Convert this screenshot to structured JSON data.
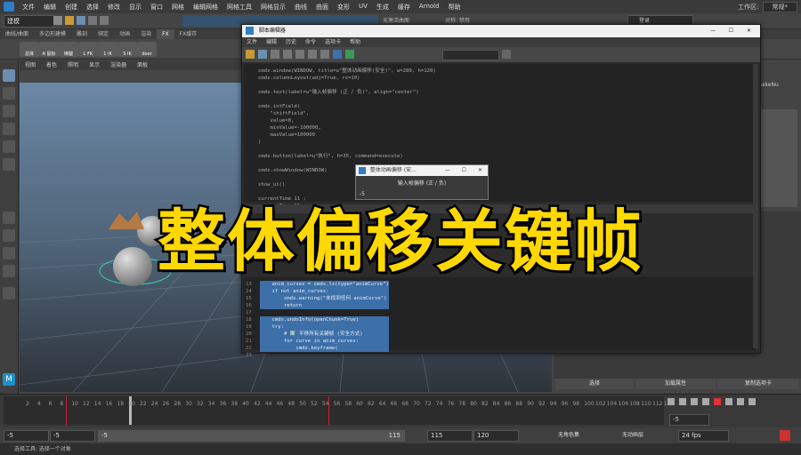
{
  "menubar": {
    "items": [
      "文件",
      "编辑",
      "创建",
      "选择",
      "修改",
      "显示",
      "窗口",
      "网格",
      "编辑网格",
      "网格工具",
      "网格显示",
      "曲线",
      "曲面",
      "变形",
      "UV",
      "生成",
      "缓存",
      "Arnold",
      "帮助"
    ],
    "workspace_label": "工作区:",
    "workspace_value": "常规*"
  },
  "toolbar": {
    "mode": "建模",
    "no_live": "无激活曲面",
    "symmetry": "对称: 禁用",
    "user": "登录"
  },
  "shelf": {
    "tabs": [
      "曲线/曲面",
      "多边形建模",
      "雕刻",
      "绑定",
      "动画",
      "渲染",
      "FX",
      "FX缓存"
    ],
    "buttons": [
      "总体",
      "A 鼠标",
      "绑腿",
      "L FK",
      "1 IK",
      "S IK",
      "door"
    ]
  },
  "viewport": {
    "menu": [
      "视图",
      "着色",
      "照明",
      "显示",
      "渲染器",
      "面板"
    ]
  },
  "script_editor": {
    "title": "脚本编辑器",
    "menu": [
      "文件",
      "编辑",
      "历史",
      "命令",
      "选项卡",
      "帮助"
    ],
    "output_lines": [
      "cmds.window(WINDOW, title=u\"整体动画偏移(安全)\", w=280, h=120)",
      "cmds.columnLayout(adj=True, rs=10)",
      "",
      "cmds.text(label=u\"输入帧偏移 (正 / 负)\", align=\"center\")",
      "",
      "cmds.intField(",
      "    \"shiftField\",",
      "    value=0,",
      "    minValue=-100000,",
      "    maxValue=100000",
      ")",
      "",
      "cmds.button(label=u\"执行\", h=35, command=execute)",
      "",
      "cmds.showWindow(WINDOW)",
      "",
      "show_ui()",
      "",
      "currentTime 11 ;",
      "currentTime 11 ;"
    ],
    "input_line_numbers": [
      "13",
      "14",
      "15",
      "16",
      "17",
      "18",
      "19",
      "20",
      "21",
      "22",
      "23"
    ],
    "input_lines": [
      "    anim_curves = cmds.ls(type=\"animCurve\")",
      "    if not anim_curves:",
      "        cmds.warning(\"未找到任何 animCurve\")",
      "        return",
      "",
      "    cmds.undoInfo(openChunk=True)",
      "    try:",
      "        # 1️⃣ 平移所有关键帧 (安全方式)",
      "        for curve in anim_curves:",
      "            cmds.keyframe(",
      ""
    ]
  },
  "popup": {
    "title": "整体动画偏移 (安...",
    "label": "输入帧偏移 (正 / 负)",
    "value": "-5"
  },
  "banner": {
    "text": "整体偏移关键帧"
  },
  "channel_box": {
    "label_node": "makeNu",
    "buttons": [
      "选择",
      "加载属性",
      "复制选项卡"
    ]
  },
  "timeline": {
    "ticks": [
      "2",
      "4",
      "6",
      "8",
      "10",
      "12",
      "14",
      "16",
      "18",
      "20",
      "22",
      "24",
      "26",
      "28",
      "30",
      "32",
      "34",
      "36",
      "38",
      "40",
      "42",
      "44",
      "46",
      "48",
      "50",
      "52",
      "54",
      "56",
      "58",
      "60",
      "62",
      "64",
      "66",
      "68",
      "70",
      "72",
      "74",
      "76",
      "78",
      "80",
      "82",
      "84",
      "86",
      "88",
      "90",
      "92",
      "94",
      "96",
      "98",
      "100",
      "102",
      "104",
      "106",
      "108",
      "110",
      "112",
      "114"
    ],
    "current_frame": "-5"
  },
  "range": {
    "start": "-5",
    "anim_start": "-5",
    "slider_start": "-5",
    "slider_end": "115",
    "end": "115",
    "anim_end": "120",
    "char_set": "无角色集",
    "anim_layer": "无动画层",
    "fps": "24 fps"
  },
  "status": {
    "text": "选择工具: 选择一个对象"
  },
  "colors": {
    "accent": "#2e7ec6",
    "banner_fill": "#ffd800",
    "selection": "#3d6fa8"
  }
}
